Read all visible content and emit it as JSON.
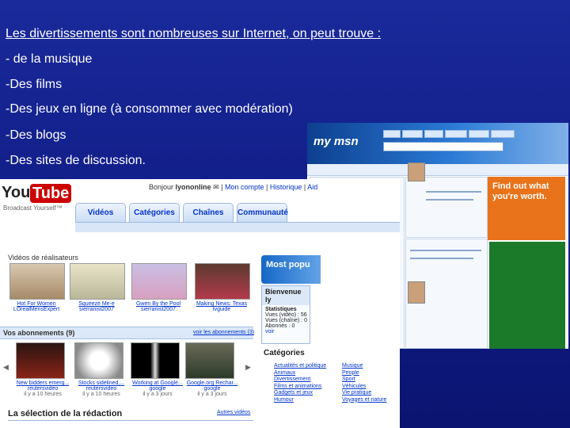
{
  "slide": {
    "title": "Les divertissements sont nombreuses sur Internet, on peut trouve :",
    "bullets": [
      "- de la musique",
      "-Des films",
      "-Des jeux en ligne (à consommer avec modération)",
      "-Des blogs",
      "-Des sites de discussion."
    ]
  },
  "msn": {
    "logo": "my msn",
    "ad_text": "Find out what you're worth."
  },
  "youtube": {
    "logo_you": "You",
    "logo_tube": "Tube",
    "tagline": "Broadcast Yourself™",
    "userbar": {
      "greeting": "Bonjour",
      "user": "lyononline",
      "account": "Mon compte",
      "history": "Historique",
      "help": "Aid"
    },
    "tabs": [
      "Vidéos",
      "Catégories",
      "Chaînes",
      "Communauté"
    ],
    "section_title": "Vidéos de réalisateurs",
    "featured": [
      {
        "title": "Hot For Women",
        "user": "LOrealMensExpert"
      },
      {
        "title": "Squeeze Me-e",
        "user": "sierranist2007"
      },
      {
        "title": "Gwen By the Pool",
        "user": "sierranist2007"
      },
      {
        "title": "Making News: Texas",
        "user": "tvguide"
      }
    ],
    "subs_title": "Vos abonnements (9)",
    "subs_link": "voir les abonnements (3)",
    "subscriptions": [
      {
        "title": "New bidders emerg...",
        "user": "reutersvideo",
        "time": "il y a 10 heures"
      },
      {
        "title": "Stocks sidelined,...",
        "user": "reutersvideo",
        "time": "il y a 10 heures"
      },
      {
        "title": "Working at Google...",
        "user": "google",
        "time": "il y a 3 jours"
      },
      {
        "title": "Google.org Rechar...",
        "user": "google",
        "time": "il y a 3 jours"
      }
    ],
    "selection": "La sélection de la rédaction",
    "selection_link": "Autres vidéos",
    "promo": "Most popu",
    "welcome": {
      "title": "Bienvenue ly",
      "stats_title": "Statistiques",
      "views_video": "Vues (vidéo) : 56",
      "views_channel": "Vues (chaîne) : 0",
      "subscribers": "Abonnés : 0",
      "see": "voir"
    },
    "categories_title": "Catégories",
    "categories_col1": [
      "Actualités et politique",
      "Animaux",
      "Divertissement",
      "Films et animations",
      "Gadgets et jeux",
      "Humour"
    ],
    "categories_col2": [
      "Musique",
      "People",
      "Sport",
      "Véhicules",
      "Vie pratique",
      "Voyages et nature"
    ]
  }
}
